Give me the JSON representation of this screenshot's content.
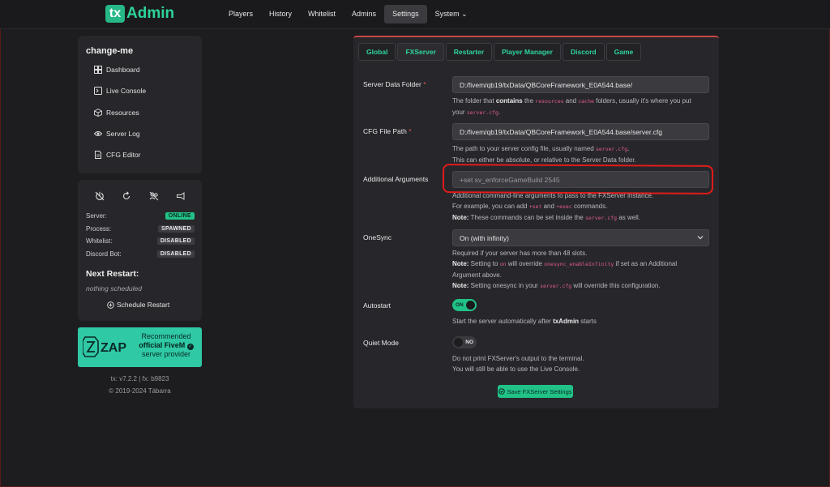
{
  "app": {
    "logo_mark": "tx",
    "logo_text": "Admin"
  },
  "nav": [
    {
      "label": "Players"
    },
    {
      "label": "History"
    },
    {
      "label": "Whitelist"
    },
    {
      "label": "Admins"
    },
    {
      "label": "Settings",
      "active": true
    },
    {
      "label": "System ⌄"
    }
  ],
  "sidebar": {
    "server_name": "change-me",
    "links": [
      {
        "label": "Dashboard",
        "icon": "dashboard-icon"
      },
      {
        "label": "Live Console",
        "icon": "terminal-icon"
      },
      {
        "label": "Resources",
        "icon": "box-icon"
      },
      {
        "label": "Server Log",
        "icon": "eye-icon"
      },
      {
        "label": "CFG Editor",
        "icon": "file-icon"
      }
    ],
    "status": [
      {
        "label": "Server:",
        "value": "ONLINE",
        "color": "#21c288"
      },
      {
        "label": "Process:",
        "value": "SPAWNED"
      },
      {
        "label": "Whitelist:",
        "value": "DISABLED"
      },
      {
        "label": "Discord Bot:",
        "value": "DISABLED"
      }
    ],
    "next_restart_title": "Next Restart:",
    "next_restart_value": "nothing scheduled",
    "schedule_button": "Schedule Restart",
    "promo": {
      "line1": "Recommended",
      "line2": "official FiveM",
      "line3": "server provider",
      "logo_text": "ZAP"
    },
    "footer_version": "tx: v7.2.2 | fx: b9823",
    "footer_copyright": "© 2019-2024 Tábarra"
  },
  "tabs": [
    {
      "label": "Global"
    },
    {
      "label": "FXServer",
      "active": true
    },
    {
      "label": "Restarter"
    },
    {
      "label": "Player Manager"
    },
    {
      "label": "Discord"
    },
    {
      "label": "Game"
    }
  ],
  "form": {
    "data_folder": {
      "label": "Server Data Folder",
      "value": "D:/fivem/qb19/txData/QBCoreFramework_E0A544.base/",
      "help": [
        "The folder that ",
        "contains",
        " the ",
        "resources",
        " and ",
        "cache",
        " folders, usually it's where you put",
        "your ",
        "server.cfg",
        "."
      ]
    },
    "cfg_path": {
      "label": "CFG File Path",
      "value": "D:/fivem/qb19/txData/QBCoreFramework_E0A544.base/server.cfg",
      "help1a": "The path to your server config file, usually named ",
      "help1b": "server.cfg",
      "help1c": ".",
      "help2": "This can either be absolute, or relative to the Server Data folder."
    },
    "additional_args": {
      "label": "Additional Arguments",
      "placeholder": "+set sv_enforceGameBuild 2545",
      "help1a": "Additional",
      "help1b": " command-line arguments to pass to the FXServer instance.",
      "help2a": "For example, you can add ",
      "help2b": "+set",
      "help2c": " and ",
      "help2d": "+exec",
      "help2e": " commands.",
      "help3a": "Note:",
      "help3b": " These commands can be set inside the ",
      "help3c": "server.cfg",
      "help3d": " as well."
    },
    "onesync": {
      "label": "OneSync",
      "value": "On (with infinity)",
      "help1": "Required if your server has more than 48 slots.",
      "help2a": "Note:",
      "help2b": " Setting to ",
      "help2c": "on",
      "help2d": " will override ",
      "help2e": "onesync_enableInfinity",
      "help2f": " if set as an Additional",
      "help3": "Argument above.",
      "help4a": "Note:",
      "help4b": " Setting onesync in your ",
      "help4c": "server.cfg",
      "help4d": " will override this configuration."
    },
    "autostart": {
      "label": "Autostart",
      "toggle": "ON",
      "help_a": "Start the server automatically after ",
      "help_b": "txAdmin",
      "help_c": " starts"
    },
    "quiet": {
      "label": "Quiet Mode",
      "toggle": "NO",
      "help1": "Do not print FXServer's output to the terminal.",
      "help2": "You will still be able to use the Live Console."
    },
    "save_label": "Save FXServer Settings"
  }
}
